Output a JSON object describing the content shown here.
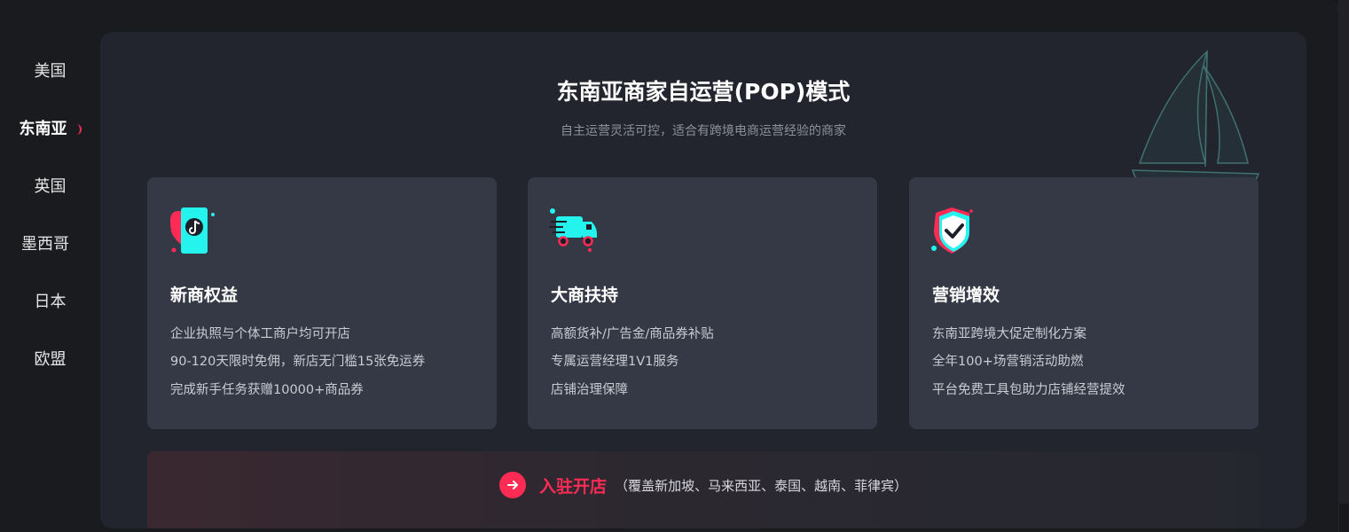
{
  "sidebar": {
    "items": [
      {
        "label": "美国"
      },
      {
        "label": "东南亚",
        "active": true
      },
      {
        "label": "英国"
      },
      {
        "label": "墨西哥"
      },
      {
        "label": "日本"
      },
      {
        "label": "欧盟"
      }
    ]
  },
  "main": {
    "title": "东南亚商家自运营(POP)模式",
    "subtitle": "自主运营灵活可控，适合有跨境电商运营经验的商家",
    "cards": [
      {
        "icon": "phone-heart-tiktok-icon",
        "title": "新商权益",
        "lines": [
          "企业执照与个体工商户均可开店",
          "90-120天限时免佣，新店无门槛15张免运券",
          "完成新手任务获赠10000+商品券"
        ]
      },
      {
        "icon": "delivery-truck-icon",
        "title": "大商扶持",
        "lines": [
          "高额货补/广告金/商品券补贴",
          "专属运营经理1V1服务",
          "店铺治理保障"
        ]
      },
      {
        "icon": "shield-check-icon",
        "title": "营销增效",
        "lines": [
          "东南亚跨境大促定制化方案",
          "全年100+场营销活动助燃",
          "平台免费工具包助力店铺经营提效"
        ]
      }
    ],
    "cta": {
      "label": "入驻开店",
      "note": "（覆盖新加坡、马来西亚、泰国、越南、菲律宾）"
    }
  },
  "colors": {
    "accent": "#fe2c55",
    "cyan": "#25f4ee",
    "panel": "#22252e",
    "card": "#343945"
  }
}
